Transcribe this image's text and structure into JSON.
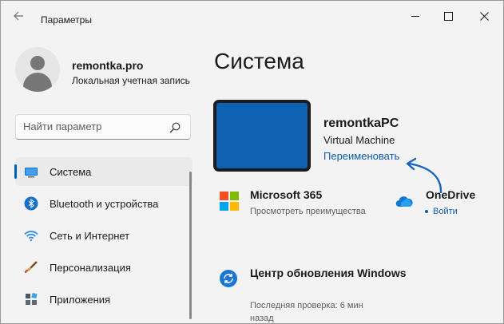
{
  "window": {
    "title": "Параметры"
  },
  "profile": {
    "name": "remontka.pro",
    "account_type": "Локальная учетная запись"
  },
  "search": {
    "placeholder": "Найти параметр"
  },
  "nav": {
    "items": [
      {
        "label": "Система",
        "icon": "monitor-icon",
        "active": true
      },
      {
        "label": "Bluetooth и устройства",
        "icon": "bluetooth-icon",
        "active": false
      },
      {
        "label": "Сеть и Интернет",
        "icon": "wifi-icon",
        "active": false
      },
      {
        "label": "Персонализация",
        "icon": "brush-icon",
        "active": false
      },
      {
        "label": "Приложения",
        "icon": "apps-icon",
        "active": false
      }
    ]
  },
  "main": {
    "title": "Система",
    "device": {
      "name": "remontkaPC",
      "model": "Virtual Machine",
      "rename_label": "Переименовать"
    },
    "tiles": {
      "m365": {
        "title": "Microsoft 365",
        "subtitle": "Просмотреть преимущества"
      },
      "onedrive": {
        "title": "OneDrive",
        "subtitle": "Войти"
      },
      "update": {
        "title": "Центр обновления Windows",
        "subtitle": "Последняя проверка: 6 мин назад"
      }
    }
  },
  "colors": {
    "accent": "#005fb8",
    "link": "#0b5cad",
    "desktop": "#0f62b3",
    "annotation_arrow": "#1565c0"
  }
}
